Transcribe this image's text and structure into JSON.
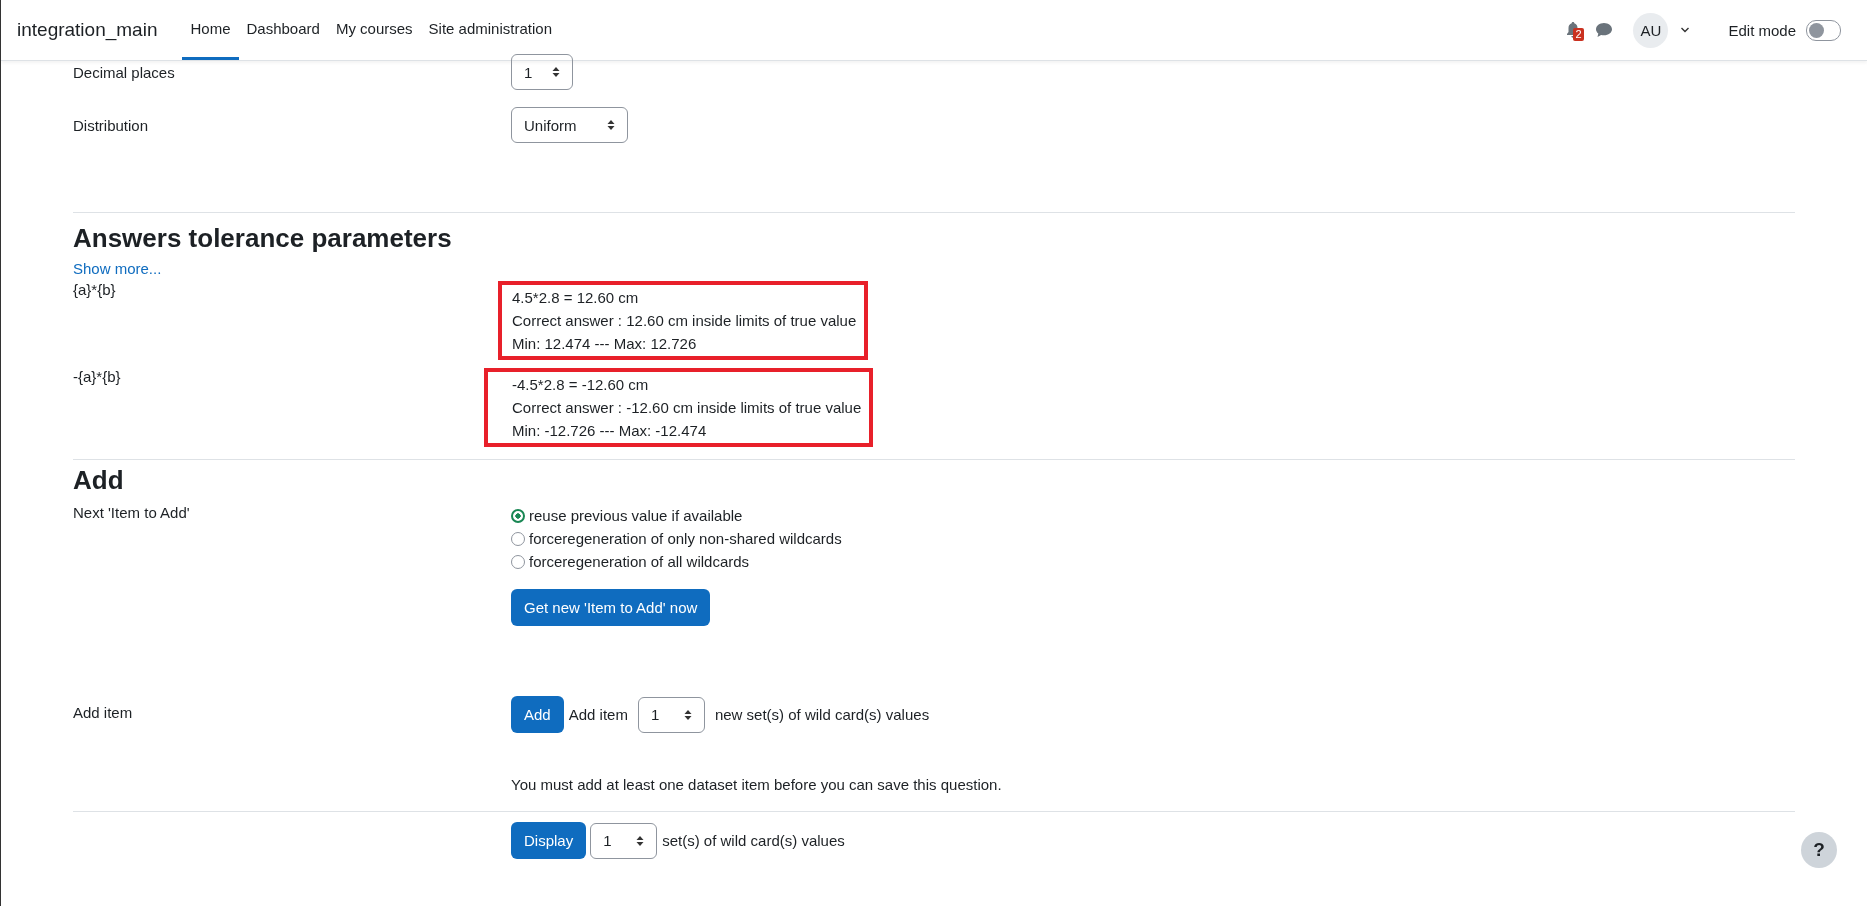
{
  "navbar": {
    "brand": "integration_main",
    "links": [
      {
        "label": "Home",
        "selected": true
      },
      {
        "label": "Dashboard",
        "selected": false
      },
      {
        "label": "My courses",
        "selected": false
      },
      {
        "label": "Site administration",
        "selected": false
      }
    ],
    "notification_count": "2",
    "avatar": "AU",
    "edit_mode": {
      "label": "Edit mode",
      "on": false
    }
  },
  "settings": [
    {
      "label": "Decimal places",
      "value": "1"
    },
    {
      "label": "Distribution",
      "value": "Uniform"
    }
  ],
  "tolerance": {
    "heading": "Answers tolerance parameters",
    "show_more": "Show more...",
    "answers": [
      {
        "formula": "{a}*{b}",
        "lines": [
          "4.5*2.8 = 12.60 cm",
          "Correct answer : 12.60 cm inside limits of true value",
          "Min: 12.474 --- Max: 12.726"
        ]
      },
      {
        "formula": "-{a}*{b}",
        "lines": [
          "-4.5*2.8 = -12.60 cm",
          "Correct answer : -12.60 cm inside limits of true value",
          "Min: -12.726 --- Max: -12.474"
        ]
      }
    ]
  },
  "add": {
    "heading": "Add",
    "next_label": "Next 'Item to Add'",
    "options": [
      {
        "label": "reuse previous value if available",
        "selected": true
      },
      {
        "label": "forceregeneration of only non-shared wildcards",
        "selected": false
      },
      {
        "label": "forceregeneration of all wildcards",
        "selected": false
      }
    ],
    "get_button": "Get new 'Item to Add' now",
    "add_item_label": "Add item",
    "add_button": "Add",
    "add_item_text": "Add item",
    "add_count": "1",
    "add_suffix": "new set(s) of wild card(s) values",
    "message": "You must add at least one dataset item before you can save this question.",
    "display_button": "Display",
    "display_count": "1",
    "display_suffix": "set(s) of wild card(s) values"
  },
  "help": "?"
}
